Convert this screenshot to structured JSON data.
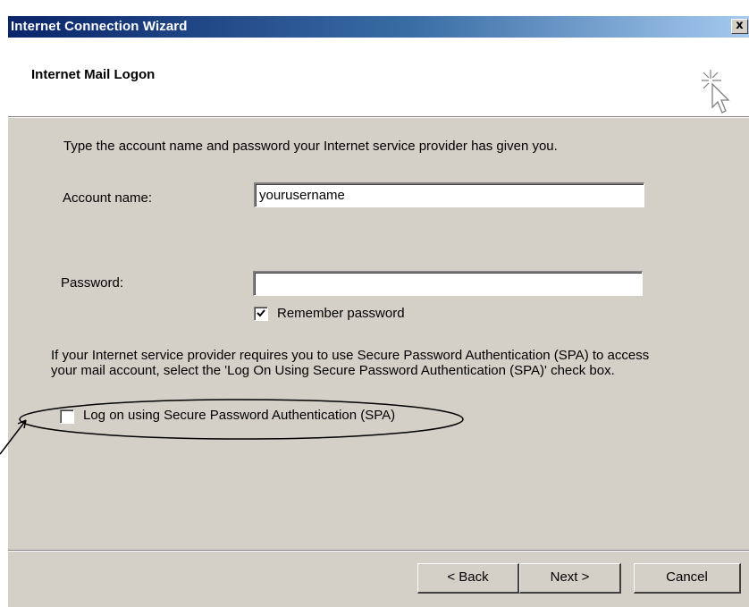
{
  "window": {
    "title": "Internet Connection Wizard",
    "close_label": "x"
  },
  "header": {
    "title": "Internet Mail Logon",
    "icon": "wizard-cursor-icon"
  },
  "main": {
    "intro": "Type the account name and password your Internet service provider has given you.",
    "account": {
      "label": "Account name:",
      "value": "yourusername"
    },
    "password": {
      "label": "Password:",
      "value": ""
    },
    "remember": {
      "label": "Remember password",
      "checked": true
    },
    "spa_description": "If your Internet service provider requires you to use Secure Password Authentication (SPA) to access your mail account, select the 'Log On Using Secure Password Authentication (SPA)' check box.",
    "spa": {
      "label": "Log on using Secure Password Authentication (SPA)",
      "checked": false
    }
  },
  "footer": {
    "back_label": "< Back",
    "next_label": "Next >",
    "cancel_label": "Cancel"
  },
  "annotation": {
    "shape": "ellipse-with-arrow",
    "color": "#000000"
  }
}
